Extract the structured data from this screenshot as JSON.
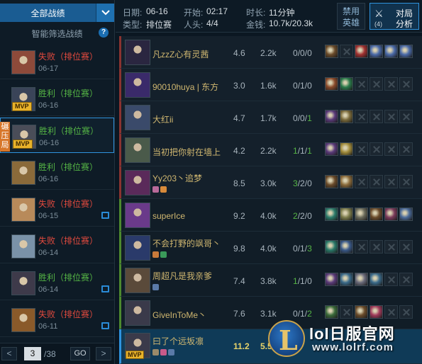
{
  "sidebar": {
    "filter_label": "全部战绩",
    "smart_filter_label": "智能筛选战绩",
    "help_label": "?",
    "crush_badge": "碾压局",
    "games": [
      {
        "result": "失败（排位赛）",
        "date": "06-17",
        "outcome": "loss",
        "mvp": false,
        "shot": false,
        "color": "#8d4a3a"
      },
      {
        "result": "胜利（排位赛）",
        "date": "06-16",
        "outcome": "win",
        "mvp": true,
        "shot": false,
        "color": "#3a4458"
      },
      {
        "result": "胜利（排位赛）",
        "date": "06-16",
        "outcome": "win",
        "mvp": true,
        "shot": false,
        "color": "#4a4d58"
      },
      {
        "result": "胜利（排位赛）",
        "date": "06-16",
        "outcome": "win",
        "mvp": false,
        "shot": false,
        "color": "#8a6a3a"
      },
      {
        "result": "失败（排位赛）",
        "date": "06-15",
        "outcome": "loss",
        "mvp": false,
        "shot": true,
        "color": "#b88a5a"
      },
      {
        "result": "失败（排位赛）",
        "date": "06-14",
        "outcome": "loss",
        "mvp": false,
        "shot": false,
        "color": "#7a92a8"
      },
      {
        "result": "胜利（排位赛）",
        "date": "06-14",
        "outcome": "win",
        "mvp": false,
        "shot": true,
        "color": "#3e3a4a"
      },
      {
        "result": "失败（排位赛）",
        "date": "06-11",
        "outcome": "loss",
        "mvp": false,
        "shot": true,
        "color": "#8a5a2a"
      }
    ],
    "mvp_label": "MVP",
    "pager": {
      "prev": "<",
      "current": "3",
      "total": "/38",
      "go": "GO",
      "next": ">"
    }
  },
  "header": {
    "date_label": "日期:",
    "date_value": "06-16",
    "start_label": "开始:",
    "start_value": "02:17",
    "duration_label": "时长:",
    "duration_value": "11分钟",
    "type_label": "类型:",
    "type_value": "排位赛",
    "people_label": "人头:",
    "people_value": "4/4",
    "gold_label": "金钱:",
    "gold_value": "10.7k/20.3k",
    "ban_line1": "禁用",
    "ban_line2": "英雄",
    "compare_line1": "对局",
    "compare_line2": "分析",
    "compare_count": "(4)"
  },
  "players": [
    {
      "name": "凡zzZ心有灵茜",
      "score": "4.6",
      "gold": "2.2k",
      "kda_k": "0",
      "kda_d": "0",
      "kda_a": "0",
      "team": "r",
      "hero_color": "#2a2640",
      "items": [
        "#6a4b2a",
        "x",
        "#a03030",
        "#4a6aa8",
        "#4a6aa8",
        "#4a6aa8"
      ]
    },
    {
      "name": "90010huya | 东方",
      "score": "3.0",
      "gold": "1.6k",
      "kda_k": "0",
      "kda_d": "1",
      "kda_a": "0",
      "team": "r",
      "hero_color": "#3a2a6a",
      "items": [
        "#8a4a2a",
        "#2a7a4a",
        "x",
        "x",
        "x",
        "x"
      ]
    },
    {
      "name": "大红ii",
      "score": "4.7",
      "gold": "1.7k",
      "kda_k": "0",
      "kda_d": "0",
      "kda_a": "1",
      "team": "r",
      "hero_color": "#3a4a6a",
      "items": [
        "#5a3a7a",
        "#7a6a3a",
        "x",
        "x",
        "x",
        "x"
      ]
    },
    {
      "name": "当初把你射在墙上",
      "score": "4.2",
      "gold": "2.2k",
      "kda_k": "1",
      "kda_d": "1",
      "kda_a": "1",
      "team": "r",
      "hero_color": "#4a5a4a",
      "items": [
        "#5a3a7a",
        "#a08a3a",
        "x",
        "x",
        "x",
        "x"
      ]
    },
    {
      "name": "Yy203丶追梦",
      "score": "8.5",
      "gold": "3.0k",
      "kda_k": "3",
      "kda_d": "2",
      "kda_a": "0",
      "team": "r",
      "hero_color": "#5a2a5a",
      "items": [
        "#6a4b2a",
        "#8a6a3a",
        "x",
        "x",
        "x",
        "x"
      ]
    },
    {
      "name": "superIce",
      "score": "9.2",
      "gold": "4.0k",
      "kda_k": "2",
      "kda_d": "2",
      "kda_a": "0",
      "team": "b",
      "hero_color": "#6a3a8a",
      "items": [
        "#2a7a6a",
        "#7a7a4a",
        "#6a6a5a",
        "#6a4b2a",
        "#7a3a5a",
        "#4a6a9a"
      ]
    },
    {
      "name": "不会打野的飒哥丶",
      "score": "9.8",
      "gold": "4.0k",
      "kda_k": "0",
      "kda_d": "1",
      "kda_a": "3",
      "team": "b",
      "hero_color": "#2a3a6a",
      "items": [
        "#2a7a6a",
        "#3a5a8a",
        "x",
        "x",
        "x",
        "x"
      ]
    },
    {
      "name": "周超凡是我亲爹",
      "score": "7.4",
      "gold": "3.8k",
      "kda_k": "1",
      "kda_d": "1",
      "kda_a": "0",
      "team": "b",
      "hero_color": "#5a4a3a",
      "items": [
        "#5a3a7a",
        "#3a6a8a",
        "#6a6a7a",
        "#3a6a8a",
        "x",
        "x"
      ]
    },
    {
      "name": "GiveInToMe丶",
      "score": "7.6",
      "gold": "3.1k",
      "kda_k": "0",
      "kda_d": "1",
      "kda_a": "2",
      "team": "b",
      "hero_color": "#3a3a4a",
      "items": [
        "#3a6a3a",
        "x",
        "#6a4b2a",
        "#a03a5a",
        "x",
        "x"
      ]
    },
    {
      "name": "曰了个远坂凛",
      "score": "11.2",
      "gold": "5.5",
      "kda_k": "",
      "kda_d": "",
      "kda_a": "",
      "team": "me",
      "hero_color": "#3a3a4a",
      "items": []
    }
  ],
  "watermark": {
    "title": "lol日服官网",
    "url": "www.lolrf.com"
  }
}
